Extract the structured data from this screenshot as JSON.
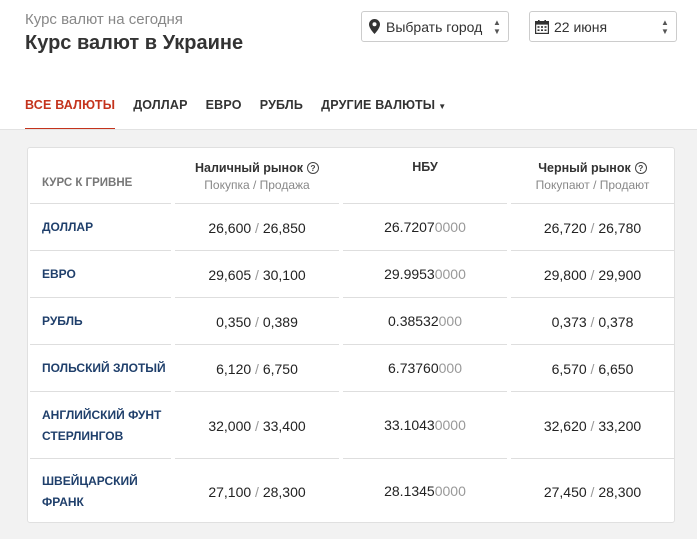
{
  "header": {
    "subtitle": "Курс валют на сегодня",
    "title": "Курс валют в Украине"
  },
  "selects": {
    "city": "Выбрать город",
    "date": "22 июня"
  },
  "tabs": [
    {
      "label": "ВСЕ ВАЛЮТЫ"
    },
    {
      "label": "ДОЛЛАР"
    },
    {
      "label": "ЕВРО"
    },
    {
      "label": "РУБЛЬ"
    },
    {
      "label": "ДРУГИЕ ВАЛЮТЫ"
    }
  ],
  "table": {
    "col0": "КУРС К ГРИВНЕ",
    "cash": {
      "title": "Наличный рынок",
      "sub": "Покупка / Продажа"
    },
    "nbu": {
      "title": "НБУ"
    },
    "black": {
      "title": "Черный рынок",
      "sub": "Покупают / Продают"
    },
    "sep": "/",
    "rows": [
      {
        "name": "ДОЛЛАР",
        "cash_buy": "26,600",
        "cash_sell": "26,850",
        "nbu_main": "26.7207",
        "nbu_tail": "0000",
        "black_buy": "26,720",
        "black_sell": "26,780"
      },
      {
        "name": "ЕВРО",
        "cash_buy": "29,605",
        "cash_sell": "30,100",
        "nbu_main": "29.9953",
        "nbu_tail": "0000",
        "black_buy": "29,800",
        "black_sell": "29,900"
      },
      {
        "name": "РУБЛЬ",
        "cash_buy": "0,350",
        "cash_sell": "0,389",
        "nbu_main": "0.38532",
        "nbu_tail": "000",
        "black_buy": "0,373",
        "black_sell": "0,378"
      },
      {
        "name": "ПОЛЬСКИЙ ЗЛОТЫЙ",
        "cash_buy": "6,120",
        "cash_sell": "6,750",
        "nbu_main": "6.73760",
        "nbu_tail": "000",
        "black_buy": "6,570",
        "black_sell": "6,650"
      },
      {
        "name": "АНГЛИЙСКИЙ ФУНТ СТЕРЛИНГОВ",
        "cash_buy": "32,000",
        "cash_sell": "33,400",
        "nbu_main": "33.1043",
        "nbu_tail": "0000",
        "black_buy": "32,620",
        "black_sell": "33,200"
      },
      {
        "name": "ШВЕЙЦАРСКИЙ ФРАНК",
        "cash_buy": "27,100",
        "cash_sell": "28,300",
        "nbu_main": "28.1345",
        "nbu_tail": "0000",
        "black_buy": "27,450",
        "black_sell": "28,300"
      }
    ]
  },
  "colors": {
    "accent": "#c4331c",
    "link": "#1f3f6b"
  },
  "icons": {
    "city": "map-pin-icon",
    "date": "calendar-icon",
    "help": "question-circle-icon"
  }
}
